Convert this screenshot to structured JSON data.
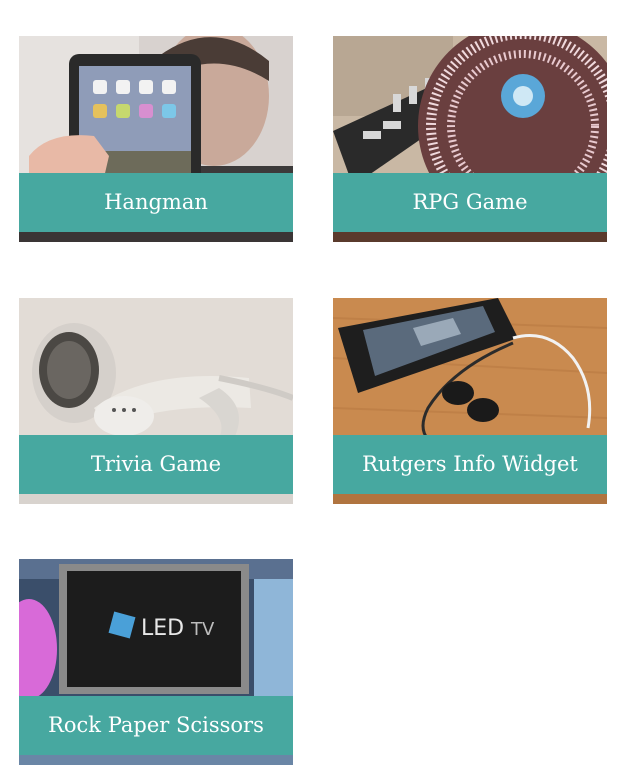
{
  "projects": [
    {
      "title": "Hangman",
      "image": "tablet-photo"
    },
    {
      "title": "RPG Game",
      "image": "turntable-photo"
    },
    {
      "title": "Trivia Game",
      "image": "earbuds-photo"
    },
    {
      "title": "Rutgers Info Widget",
      "image": "phone-headphones-photo"
    },
    {
      "title": "Rock Paper Scissors",
      "image": "led-tv-photo"
    }
  ],
  "colors": {
    "caption_bg": "#47a8a0",
    "caption_text": "#ffffff",
    "page_bg": "#ffffff"
  }
}
